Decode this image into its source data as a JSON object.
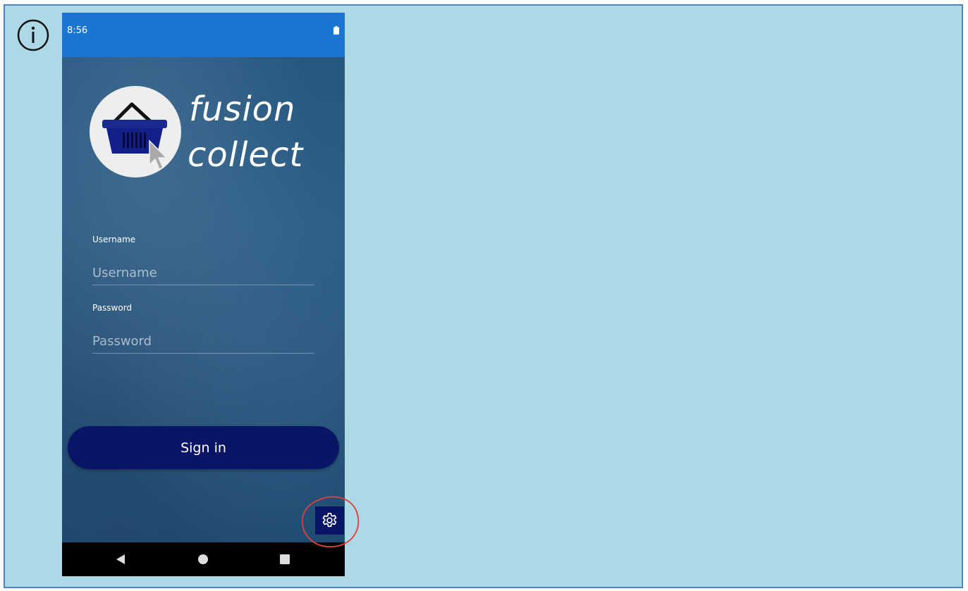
{
  "status_bar": {
    "time": "8:56"
  },
  "brand": {
    "line1": "fusion",
    "line2": "collect"
  },
  "form": {
    "username_label": "Username",
    "username_placeholder": "Username",
    "username_value": "",
    "password_label": "Password",
    "password_placeholder": "Password",
    "password_value": ""
  },
  "actions": {
    "signin_label": "Sign in"
  },
  "icons": {
    "info": "info-icon",
    "battery": "battery-icon",
    "logo": "shopping-basket-cursor-icon",
    "settings": "gear-icon",
    "nav_back": "triangle-back-icon",
    "nav_home": "circle-home-icon",
    "nav_recent": "square-recent-icon"
  },
  "colors": {
    "background": "#add8e6",
    "status_bar": "#1a76d2",
    "button": "#0a1566",
    "annotation": "#e0403a"
  }
}
